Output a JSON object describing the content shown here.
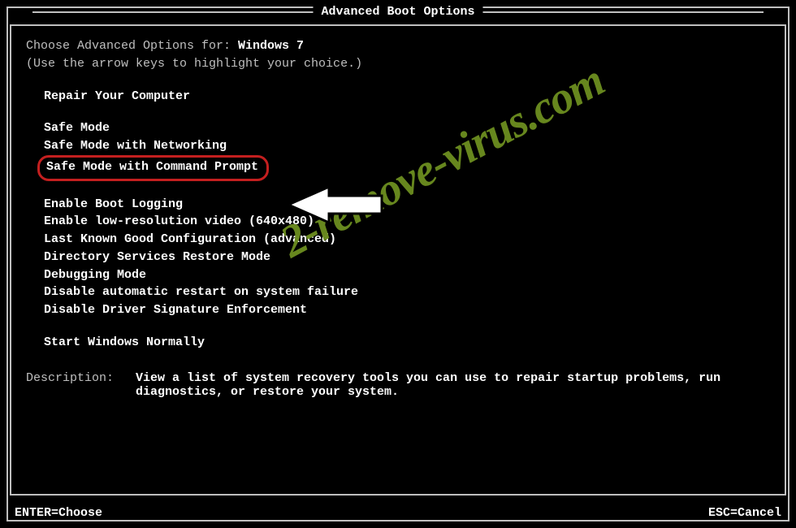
{
  "title": "Advanced Boot Options",
  "choose_label": "Choose Advanced Options for: ",
  "os_name": "Windows 7",
  "hint": "(Use the arrow keys to highlight your choice.)",
  "group1": [
    "Repair Your Computer"
  ],
  "group2": [
    "Safe Mode",
    "Safe Mode with Networking",
    "Safe Mode with Command Prompt"
  ],
  "selected_index": 2,
  "group3": [
    "Enable Boot Logging",
    "Enable low-resolution video (640x480)",
    "Last Known Good Configuration (advanced)",
    "Directory Services Restore Mode",
    "Debugging Mode",
    "Disable automatic restart on system failure",
    "Disable Driver Signature Enforcement"
  ],
  "group4": [
    "Start Windows Normally"
  ],
  "description": {
    "label": "Description:",
    "text": "View a list of system recovery tools you can use to repair startup problems, run diagnostics, or restore your system."
  },
  "footer": {
    "enter": "ENTER=Choose",
    "esc": "ESC=Cancel"
  },
  "watermark": "2-remove-virus.com"
}
